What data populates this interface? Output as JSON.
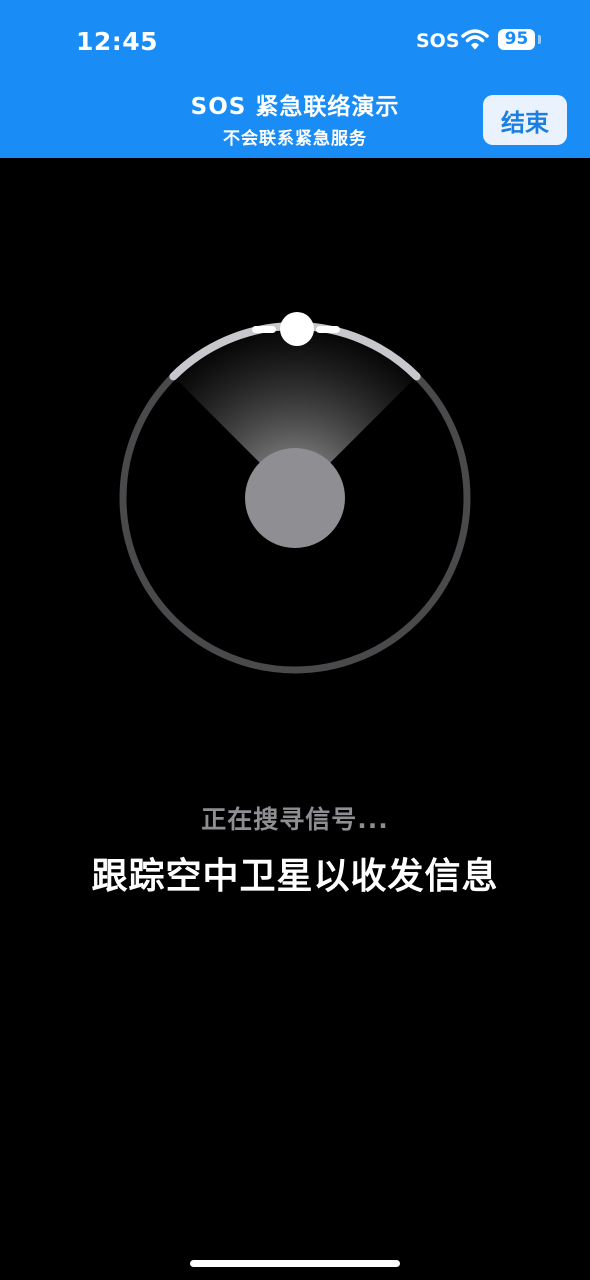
{
  "status_bar": {
    "time": "12:45",
    "sos": "SOS",
    "battery": "95",
    "wifi_icon": "wifi-icon"
  },
  "banner": {
    "title": "SOS 紧急联络演示",
    "subtitle": "不会联系紧急服务",
    "end_label": "结束",
    "color": "#1a8cf5"
  },
  "tracker": {
    "center_icon": "phone-center-circle",
    "satellite_icon": "satellite-marker-icon"
  },
  "main": {
    "status": "正在搜寻信号...",
    "instruction": "跟踪空中卫星以收发信息"
  }
}
